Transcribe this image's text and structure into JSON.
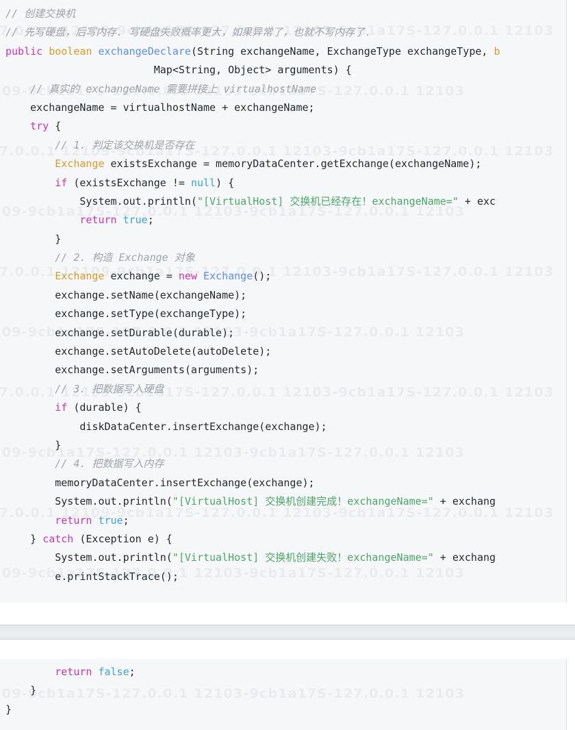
{
  "document": {
    "kind": "java-code-snippet",
    "language": "Java",
    "background_color": "#f6f7f8",
    "page_background": "#ffffff",
    "divider_color": "#e6e8eb"
  },
  "theme": {
    "comment": "#a0a4ab",
    "keyword": "#cc34b5",
    "type": "#d99b2a",
    "function": "#5b8dee",
    "literal": "#3ba3e0",
    "string": "#4ba767",
    "plain": "#24292e"
  },
  "watermark": {
    "text": "127.0.0.1 12109-9cb1a17S-127.0.0.1 12103-9cb1a17S-127.0.0.1 12103",
    "rows": 12,
    "color": "rgba(120,135,160,0.10)"
  },
  "code_blocks": [
    {
      "id": "block-top",
      "lines": [
        [
          {
            "t": "// 创建交换机",
            "c": "comment"
          }
        ],
        [
          {
            "t": "// 先写硬盘，后写内存. 写硬盘失败概率更大，如果异常了，也就不写内存了.",
            "c": "comment"
          }
        ],
        [
          {
            "t": "public",
            "c": "keyword"
          },
          {
            "t": " ",
            "c": "plain"
          },
          {
            "t": "boolean",
            "c": "type"
          },
          {
            "t": " ",
            "c": "plain"
          },
          {
            "t": "exchangeDeclare",
            "c": "func"
          },
          {
            "t": "(String exchangeName, ExchangeType exchangeType, ",
            "c": "plain"
          },
          {
            "t": "b",
            "c": "type"
          }
        ],
        [
          {
            "t": "                        Map<String, Object> arguments) {",
            "c": "plain"
          }
        ],
        [
          {
            "t": "    // 真实的 exchangeName 需要拼接上 virtualhostName",
            "c": "comment"
          }
        ],
        [
          {
            "t": "    exchangeName = virtualhostName + exchangeName;",
            "c": "plain"
          }
        ],
        [
          {
            "t": "    ",
            "c": "plain"
          },
          {
            "t": "try",
            "c": "keyword"
          },
          {
            "t": " {",
            "c": "plain"
          }
        ],
        [
          {
            "t": "        // 1. 判定该交换机是否存在",
            "c": "comment"
          }
        ],
        [
          {
            "t": "        ",
            "c": "plain"
          },
          {
            "t": "Exchange",
            "c": "type"
          },
          {
            "t": " existsExchange = memoryDataCenter.getExchange(exchangeName);",
            "c": "plain"
          }
        ],
        [
          {
            "t": "        ",
            "c": "plain"
          },
          {
            "t": "if",
            "c": "keyword"
          },
          {
            "t": " (existsExchange != ",
            "c": "plain"
          },
          {
            "t": "null",
            "c": "literal"
          },
          {
            "t": ") {",
            "c": "plain"
          }
        ],
        [
          {
            "t": "            System.out.println(",
            "c": "plain"
          },
          {
            "t": "\"[VirtualHost] 交换机已经存在！exchangeName=\"",
            "c": "string"
          },
          {
            "t": " + exc",
            "c": "plain"
          }
        ],
        [
          {
            "t": "            ",
            "c": "plain"
          },
          {
            "t": "return",
            "c": "keyword"
          },
          {
            "t": " ",
            "c": "plain"
          },
          {
            "t": "true",
            "c": "literal"
          },
          {
            "t": ";",
            "c": "plain"
          }
        ],
        [
          {
            "t": "        }",
            "c": "plain"
          }
        ],
        [
          {
            "t": "        // 2. 构造 Exchange 对象",
            "c": "comment"
          }
        ],
        [
          {
            "t": "        ",
            "c": "plain"
          },
          {
            "t": "Exchange",
            "c": "type"
          },
          {
            "t": " exchange = ",
            "c": "plain"
          },
          {
            "t": "new",
            "c": "keyword"
          },
          {
            "t": " ",
            "c": "plain"
          },
          {
            "t": "Exchange",
            "c": "func"
          },
          {
            "t": "();",
            "c": "plain"
          }
        ],
        [
          {
            "t": "        exchange.setName(exchangeName);",
            "c": "plain"
          }
        ],
        [
          {
            "t": "        exchange.setType(exchangeType);",
            "c": "plain"
          }
        ],
        [
          {
            "t": "        exchange.setDurable(durable);",
            "c": "plain"
          }
        ],
        [
          {
            "t": "        exchange.setAutoDelete(autoDelete);",
            "c": "plain"
          }
        ],
        [
          {
            "t": "        exchange.setArguments(arguments);",
            "c": "plain"
          }
        ],
        [
          {
            "t": "        // 3. 把数据写入硬盘",
            "c": "comment"
          }
        ],
        [
          {
            "t": "        ",
            "c": "plain"
          },
          {
            "t": "if",
            "c": "keyword"
          },
          {
            "t": " (durable) {",
            "c": "plain"
          }
        ],
        [
          {
            "t": "            diskDataCenter.insertExchange(exchange);",
            "c": "plain"
          }
        ],
        [
          {
            "t": "        }",
            "c": "plain"
          }
        ],
        [
          {
            "t": "        // 4. 把数据写入内存",
            "c": "comment"
          }
        ],
        [
          {
            "t": "        memoryDataCenter.insertExchange(exchange);",
            "c": "plain"
          }
        ],
        [
          {
            "t": "        System.out.println(",
            "c": "plain"
          },
          {
            "t": "\"[VirtualHost] 交换机创建完成！exchangeName=\"",
            "c": "string"
          },
          {
            "t": " + exchang",
            "c": "plain"
          }
        ],
        [
          {
            "t": "        ",
            "c": "plain"
          },
          {
            "t": "return",
            "c": "keyword"
          },
          {
            "t": " ",
            "c": "plain"
          },
          {
            "t": "true",
            "c": "literal"
          },
          {
            "t": ";",
            "c": "plain"
          }
        ],
        [
          {
            "t": "    } ",
            "c": "plain"
          },
          {
            "t": "catch",
            "c": "keyword"
          },
          {
            "t": " (Exception e) {",
            "c": "plain"
          }
        ],
        [
          {
            "t": "        System.out.println(",
            "c": "plain"
          },
          {
            "t": "\"[VirtualHost] 交换机创建失败！exchangeName=\"",
            "c": "string"
          },
          {
            "t": " + exchang",
            "c": "plain"
          }
        ],
        [
          {
            "t": "        e.printStackTrace();",
            "c": "plain"
          }
        ]
      ]
    },
    {
      "id": "block-bottom",
      "lines": [
        [
          {
            "t": "        ",
            "c": "plain"
          },
          {
            "t": "return",
            "c": "keyword"
          },
          {
            "t": " ",
            "c": "plain"
          },
          {
            "t": "false",
            "c": "literal"
          },
          {
            "t": ";",
            "c": "plain"
          }
        ],
        [
          {
            "t": "    }",
            "c": "plain"
          }
        ],
        [
          {
            "t": "}",
            "c": "plain"
          }
        ]
      ]
    }
  ]
}
